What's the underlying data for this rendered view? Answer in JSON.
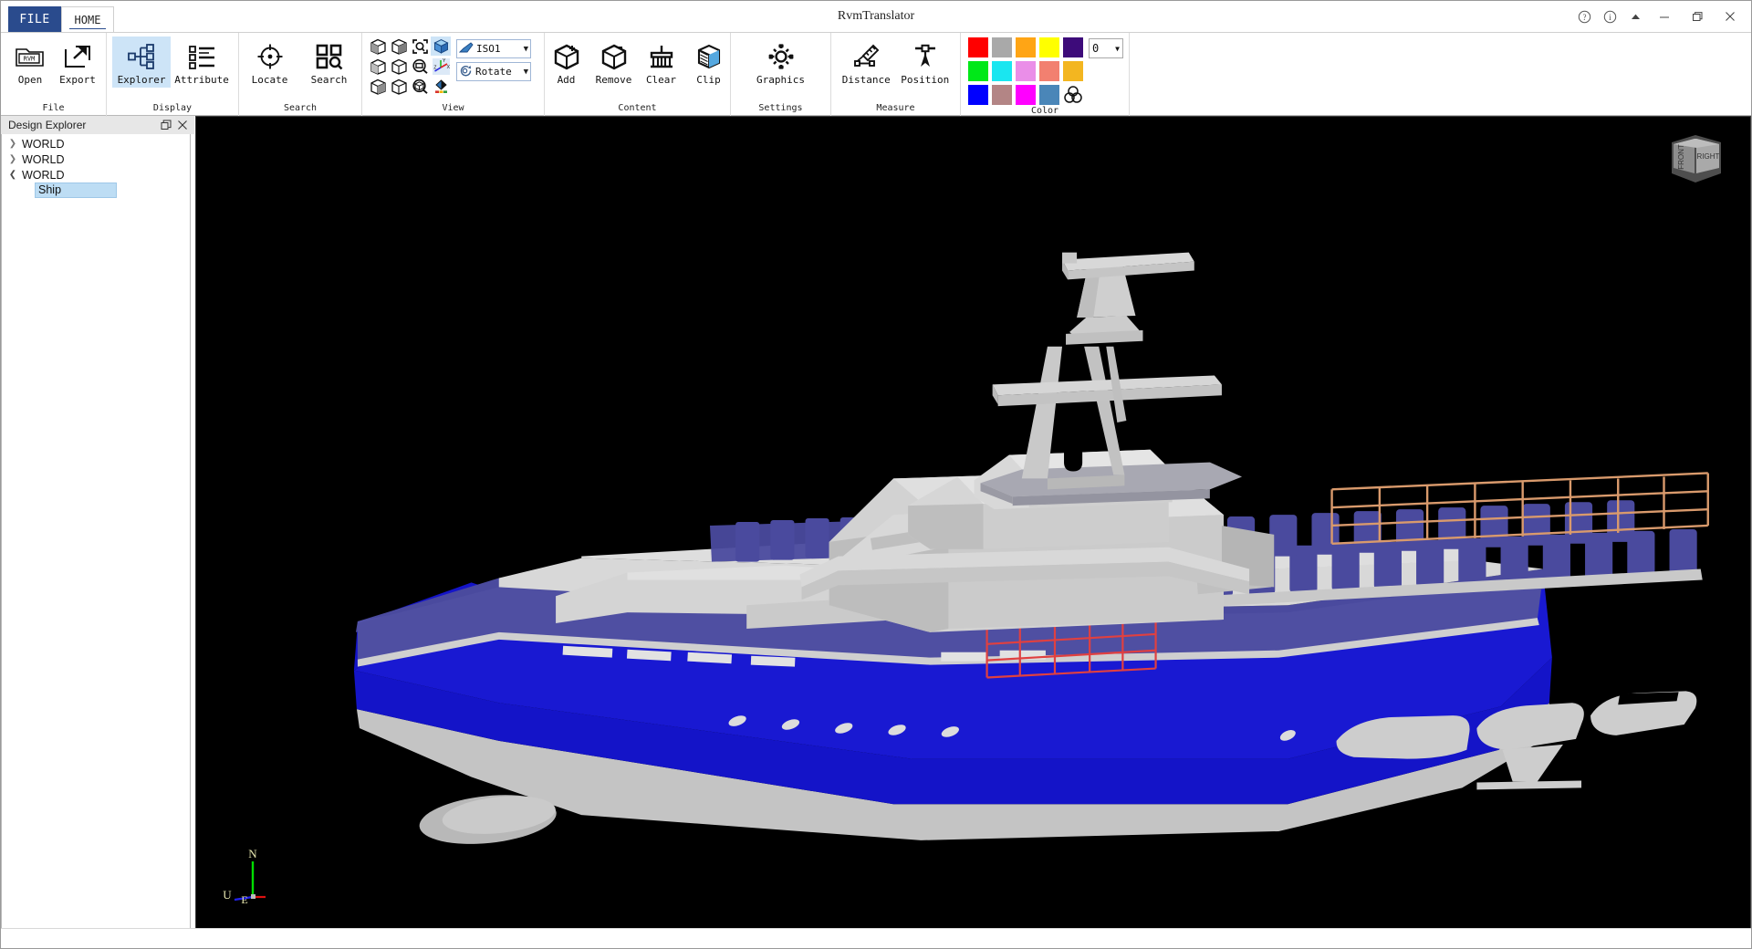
{
  "window": {
    "title": "RvmTranslator",
    "controls": [
      {
        "name": "help-button",
        "glyph": "?"
      },
      {
        "name": "info-button",
        "glyph": "i"
      },
      {
        "name": "ribbon-collapse-button",
        "glyph": "▲"
      },
      {
        "name": "minimize-button",
        "glyph": "—"
      },
      {
        "name": "maximize-button",
        "glyph": "❐"
      },
      {
        "name": "close-button",
        "glyph": "✕"
      }
    ]
  },
  "tabs": {
    "file": "FILE",
    "home": "HOME",
    "active": "HOME"
  },
  "ribbon": {
    "groups": [
      {
        "id": "file",
        "label": "File",
        "buttons": [
          {
            "id": "open",
            "label": "Open",
            "icon": "folder-rvm-icon",
            "active": false
          },
          {
            "id": "export",
            "label": "Export",
            "icon": "export-icon",
            "active": false
          }
        ]
      },
      {
        "id": "display",
        "label": "Display",
        "buttons": [
          {
            "id": "explorer",
            "label": "Explorer",
            "icon": "tree-nodes-icon",
            "active": true
          },
          {
            "id": "attribute",
            "label": "Attribute",
            "icon": "list-icon",
            "active": false
          }
        ]
      },
      {
        "id": "search",
        "label": "Search",
        "buttons": [
          {
            "id": "locate",
            "label": "Locate",
            "icon": "crosshair-icon",
            "active": false
          },
          {
            "id": "search",
            "label": "Search",
            "icon": "grid-magnifier-icon",
            "active": false
          }
        ]
      },
      {
        "id": "view",
        "label": "View",
        "cells": [
          {
            "id": "view-iso-1",
            "icon": "cube-view-icon",
            "selected": false
          },
          {
            "id": "view-iso-2",
            "icon": "cube-view-icon",
            "selected": false
          },
          {
            "id": "view-zoom-fit",
            "icon": "zoom-fit-icon",
            "selected": false
          },
          {
            "id": "view-shaded-cube",
            "icon": "shaded-cube-icon",
            "selected": true
          },
          {
            "id": "view-iso-3",
            "icon": "cube-view-icon",
            "selected": false
          },
          {
            "id": "view-iso-4",
            "icon": "cube-view-icon",
            "selected": false
          },
          {
            "id": "view-zoom-window",
            "icon": "zoom-window-icon",
            "selected": false
          },
          {
            "id": "view-axis-triad",
            "icon": "axis-triad-icon",
            "selected": false
          },
          {
            "id": "view-iso-5",
            "icon": "cube-view-icon",
            "selected": false
          },
          {
            "id": "view-iso-6",
            "icon": "cube-view-icon",
            "selected": false
          },
          {
            "id": "view-zoom-all",
            "icon": "zoom-all-icon",
            "selected": false
          },
          {
            "id": "view-render-style",
            "icon": "render-style-icon",
            "selected": false
          }
        ],
        "dropdowns": [
          {
            "id": "view-preset",
            "value": "ISO1",
            "icon": "view-preset-icon"
          },
          {
            "id": "navigation-mode",
            "value": "Rotate",
            "icon": "rotate-icon"
          }
        ]
      },
      {
        "id": "content",
        "label": "Content",
        "buttons": [
          {
            "id": "add",
            "label": "Add",
            "icon": "cube-plus-icon",
            "active": false
          },
          {
            "id": "remove",
            "label": "Remove",
            "icon": "cube-minus-icon",
            "active": false
          },
          {
            "id": "clear",
            "label": "Clear",
            "icon": "broom-icon",
            "active": false
          },
          {
            "id": "clip",
            "label": "Clip",
            "icon": "clip-cube-icon",
            "active": false
          }
        ]
      },
      {
        "id": "settings",
        "label": "Settings",
        "buttons": [
          {
            "id": "graphics",
            "label": "Graphics",
            "icon": "gear-icon",
            "active": false
          }
        ]
      },
      {
        "id": "measure",
        "label": "Measure",
        "buttons": [
          {
            "id": "distance",
            "label": "Distance",
            "icon": "ruler-icon",
            "active": false
          },
          {
            "id": "position",
            "label": "Position",
            "icon": "position-marker-icon",
            "active": false
          }
        ]
      },
      {
        "id": "color",
        "label": "Color",
        "swatches": [
          "#ff0000",
          "#a9a9a9",
          "#ffa515",
          "#ffff00",
          "#3d0b7a",
          "#00e818",
          "#1ae6f0",
          "#ea8ee8",
          "#f28070",
          "#f3b620",
          "#0000ff",
          "#b38585",
          "#ff00ff",
          "#4a86b8",
          "mix-icon"
        ],
        "transparency": {
          "id": "transparency-select",
          "value": "0"
        }
      }
    ]
  },
  "explorer": {
    "title": "Design Explorer",
    "float_icon": "restore-icon",
    "close_icon": "close-icon",
    "tree": [
      {
        "label": "WORLD",
        "expanded": false,
        "selected": false,
        "depth": 0
      },
      {
        "label": "WORLD",
        "expanded": false,
        "selected": false,
        "depth": 0
      },
      {
        "label": "WORLD",
        "expanded": true,
        "selected": false,
        "depth": 0
      },
      {
        "label": "Ship",
        "expanded": null,
        "selected": true,
        "depth": 1
      }
    ]
  },
  "viewport": {
    "background": "#000000",
    "model_name": "Ship",
    "nav_cube": {
      "front_face": "FRONT",
      "right_face": "RIGHT"
    },
    "axis_indicator": {
      "north": {
        "label": "N",
        "color": "#00ff00"
      },
      "east": {
        "label": "E",
        "color": "#ff0000"
      },
      "up": {
        "label": "U",
        "color": "#2020ff"
      }
    },
    "colors": {
      "hull_blue": "#1414c8",
      "bulwark_blue": "#4a4a9e",
      "deck_gray": "#d2d2d2",
      "super_gray": "#cfcfcf",
      "boot_gray": "#c8c8c8",
      "rail_orange": "#d99a6c",
      "rail_red": "#e04040"
    }
  }
}
